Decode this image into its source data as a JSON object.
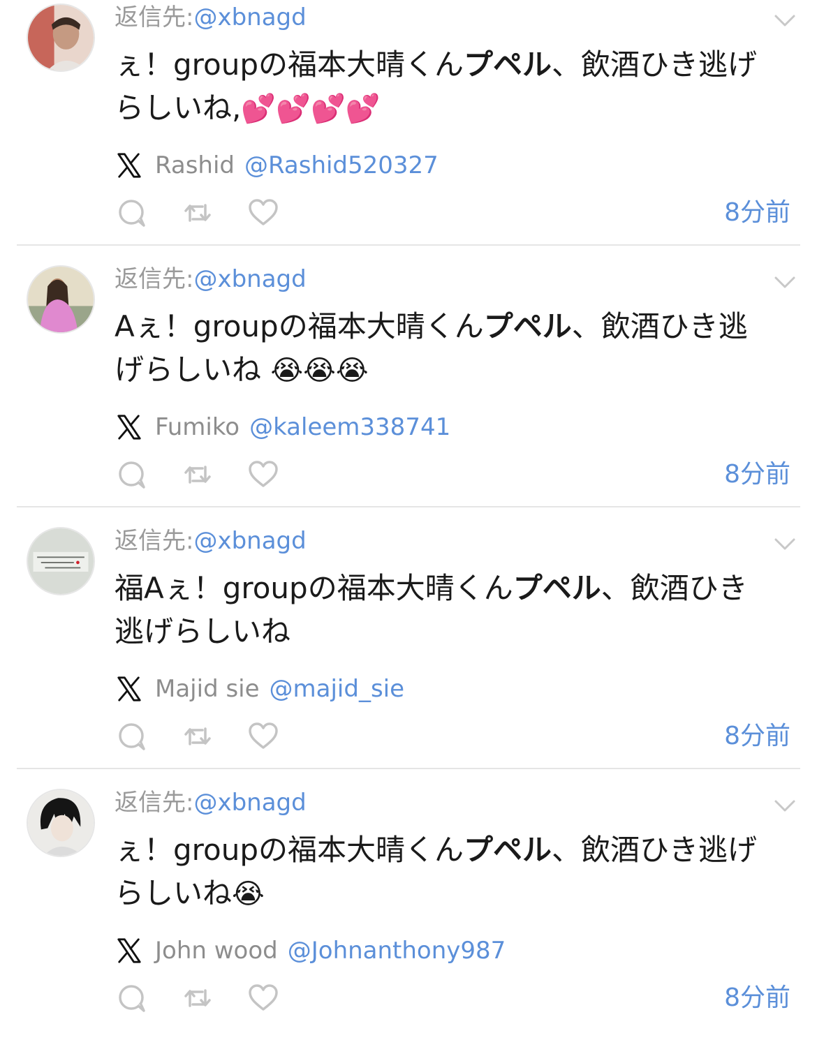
{
  "reply_prefix": "返信先:",
  "replies": [
    {
      "reply_to": "@xbnagd",
      "text_pre": "ぇ！groupの福本大晴くん",
      "text_bold": "プペル",
      "text_post": "、飲酒ひき逃げらしいね,",
      "emoji": "💕💕💕💕",
      "author_name": "Rashid",
      "author_handle": "@Rashid520327",
      "time": "8分前",
      "avatar_color": "#b88a78"
    },
    {
      "reply_to": "@xbnagd",
      "text_pre": "Aぇ！groupの福本大晴くん",
      "text_bold": "プペル",
      "text_post": "、飲酒ひき逃げらしいね ",
      "emoji": "😭😭😭",
      "author_name": "Fumiko",
      "author_handle": "@kaleem338741",
      "time": "8分前",
      "avatar_color": "#d88ac8"
    },
    {
      "reply_to": "@xbnagd",
      "text_pre": "福Aぇ！groupの福本大晴くん",
      "text_bold": "プペル",
      "text_post": "、飲酒ひき逃げらしいね",
      "emoji": "",
      "author_name": "Majid sie",
      "author_handle": "@majid_sie",
      "time": "8分前",
      "avatar_color": "#d9dcd6"
    },
    {
      "reply_to": "@xbnagd",
      "text_pre": "ぇ！groupの福本大晴くん",
      "text_bold": "プペル",
      "text_post": "、飲酒ひき逃げらしいね",
      "emoji": "😭",
      "author_name": "John wood",
      "author_handle": "@Johnanthony987",
      "time": "8分前",
      "avatar_color": "#5a5a5a"
    }
  ],
  "icons": {
    "platform": "x-logo-icon",
    "reply": "reply-bubble-icon",
    "repost": "repost-icon",
    "like": "heart-icon",
    "menu": "chevron-down-icon"
  },
  "colors": {
    "link": "#5b8fd9",
    "muted": "#9a9a9a",
    "text": "#1a1a1a"
  }
}
